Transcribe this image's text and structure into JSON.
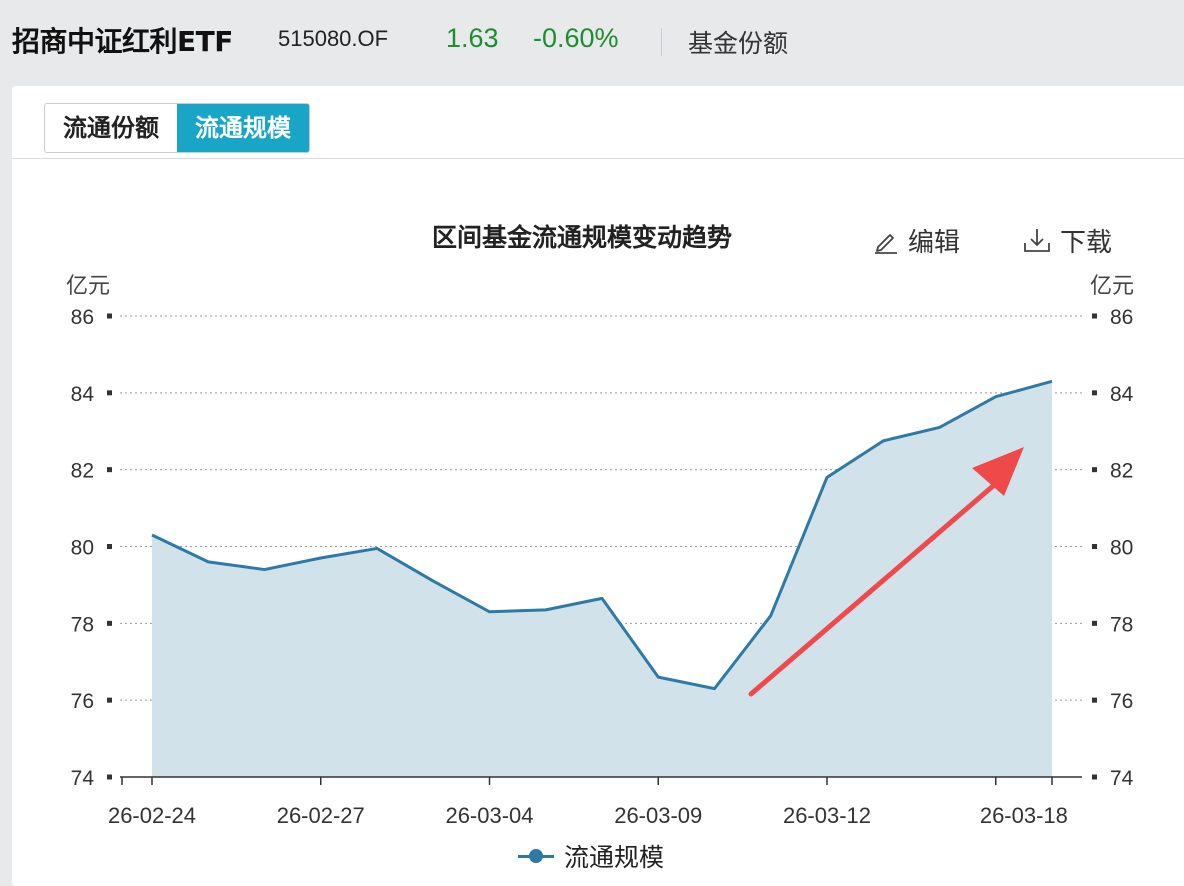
{
  "header": {
    "fund_name": "招商中证红利ETF",
    "fund_code": "515080.OF",
    "price": "1.63",
    "change": "-0.60%",
    "link": "基金份额"
  },
  "tabs": [
    {
      "label": "流通份额",
      "active": false
    },
    {
      "label": "流通规模",
      "active": true
    }
  ],
  "toolbar": {
    "edit_label": "编辑",
    "download_label": "下载",
    "edit_icon": "pencil-icon",
    "download_icon": "download-icon"
  },
  "colors": {
    "accent": "#19a5c6",
    "line": "#2e7aa6",
    "area": "#d2e2eb",
    "up_down": "#1a8f2e",
    "annotation_arrow": "#f0494a"
  },
  "chart_data": {
    "type": "area",
    "title": "区间基金流通规模变动趋势",
    "unit_left": "亿元",
    "unit_right": "亿元",
    "ylim": [
      74,
      86
    ],
    "yticks": [
      74,
      76,
      78,
      80,
      82,
      84,
      86
    ],
    "x_labels": [
      "26-02-24",
      "26-02-27",
      "26-03-04",
      "26-03-09",
      "26-03-12",
      "26-03-18"
    ],
    "series": [
      {
        "name": "流通规模",
        "values": [
          80.3,
          79.6,
          79.4,
          79.7,
          79.95,
          79.1,
          78.3,
          78.35,
          78.65,
          76.6,
          76.3,
          78.2,
          81.8,
          82.75,
          83.1,
          83.9,
          84.3
        ]
      }
    ],
    "grid": true,
    "legend": "bottom"
  }
}
